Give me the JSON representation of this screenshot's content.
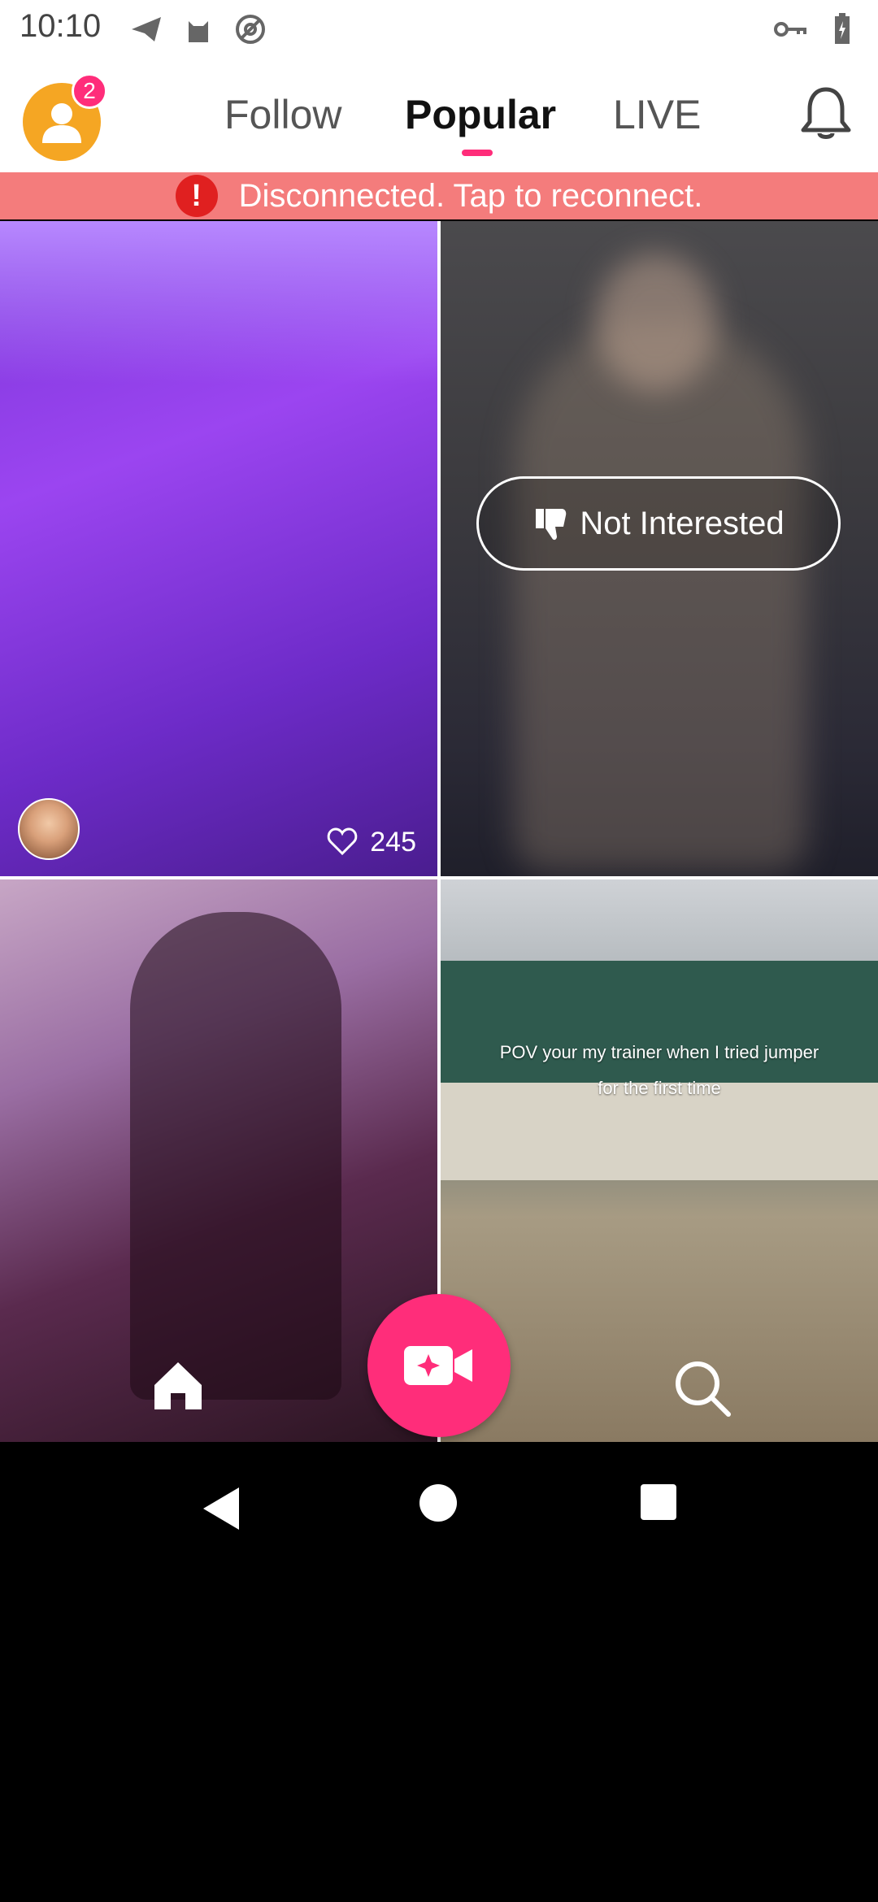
{
  "status_bar": {
    "time": "10:10"
  },
  "header": {
    "notification_count": "2",
    "tabs": [
      {
        "label": "Follow",
        "active": false
      },
      {
        "label": "Popular",
        "active": true
      },
      {
        "label": "LIVE",
        "active": false
      }
    ]
  },
  "banner": {
    "icon": "!",
    "text": "Disconnected. Tap to reconnect."
  },
  "feed": {
    "tiles": [
      {
        "likes": "245"
      },
      {
        "not_interested_label": "Not Interested"
      },
      {},
      {
        "caption_line1": "POV your my trainer when I tried jumper",
        "caption_line2": "for the first time"
      }
    ]
  },
  "colors": {
    "accent": "#ff2d7a",
    "banner": "#f47c7c",
    "avatar": "#f5a623"
  }
}
